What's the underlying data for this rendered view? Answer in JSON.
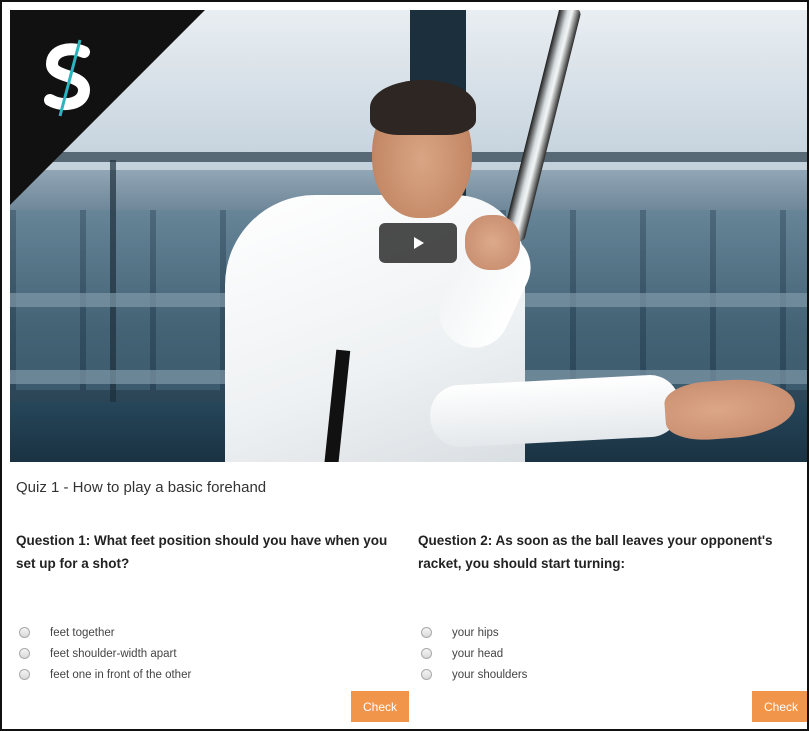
{
  "video": {
    "thumbnail_description": "",
    "play_icon": "play-icon",
    "logo_icon": "s-logo-icon"
  },
  "quiz": {
    "title": "Quiz 1 - How to play a basic forehand",
    "questions": [
      {
        "text": "Question 1: What feet position should you have when you set up for a shot?",
        "options": [
          "feet together",
          "feet shoulder-width apart",
          "feet one in front of the other"
        ],
        "check_label": "Check"
      },
      {
        "text": "Question 2: As soon as the ball leaves your opponent's racket, you should start turning:",
        "options": [
          "your hips",
          "your head",
          "your shoulders"
        ],
        "check_label": "Check"
      }
    ]
  },
  "colors": {
    "accent": "#f0954a",
    "logo_teal": "#2bb3c0"
  }
}
